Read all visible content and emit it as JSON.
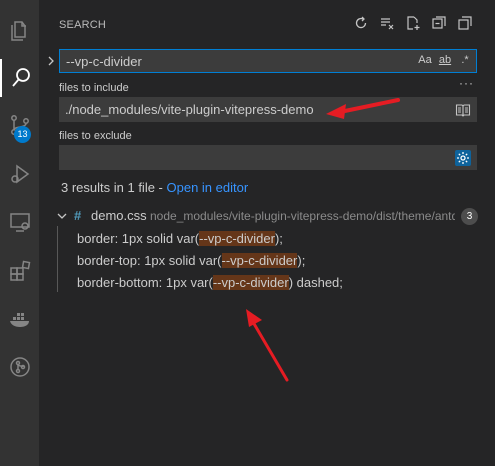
{
  "activity_bar": {
    "items": [
      {
        "name": "explorer-icon"
      },
      {
        "name": "search-icon"
      },
      {
        "name": "source-control-icon"
      },
      {
        "name": "run-debug-icon"
      },
      {
        "name": "remote-explorer-icon"
      },
      {
        "name": "extensions-icon"
      },
      {
        "name": "docker-icon"
      },
      {
        "name": "git-graph-icon"
      }
    ],
    "scm_badge": "13"
  },
  "sidebar": {
    "title": "SEARCH",
    "actions": [
      "refresh-icon",
      "clear-results-icon",
      "new-search-editor-icon",
      "collapse-all-icon",
      "view-as-tree-icon"
    ]
  },
  "search": {
    "query": "--vp-c-divider",
    "options": {
      "match_case": "Aa",
      "whole_word": "ab",
      "regex": ".*"
    },
    "more": "···"
  },
  "include": {
    "label": "files to include",
    "value": "./node_modules/vite-plugin-vitepress-demo"
  },
  "exclude": {
    "label": "files to exclude",
    "value": ""
  },
  "summary": {
    "text": "3 results in 1 file - ",
    "link": "Open in editor"
  },
  "file": {
    "icon": "#",
    "name": "demo.css",
    "path": "node_modules/vite-plugin-vitepress-demo/dist/theme/antd",
    "count": "3"
  },
  "matches": [
    {
      "before": "border: 1px solid var(",
      "match": "--vp-c-divider",
      "after": ");"
    },
    {
      "before": "border-top: 1px solid var(",
      "match": "--vp-c-divider",
      "after": ");"
    },
    {
      "before": "border-bottom: 1px var(",
      "match": "--vp-c-divider",
      "after": ") dashed;"
    }
  ],
  "colors": {
    "accent": "#007acc",
    "link": "#3794ff",
    "annotation_arrow": "#e51c23",
    "match_highlight": "#ea5c00"
  }
}
